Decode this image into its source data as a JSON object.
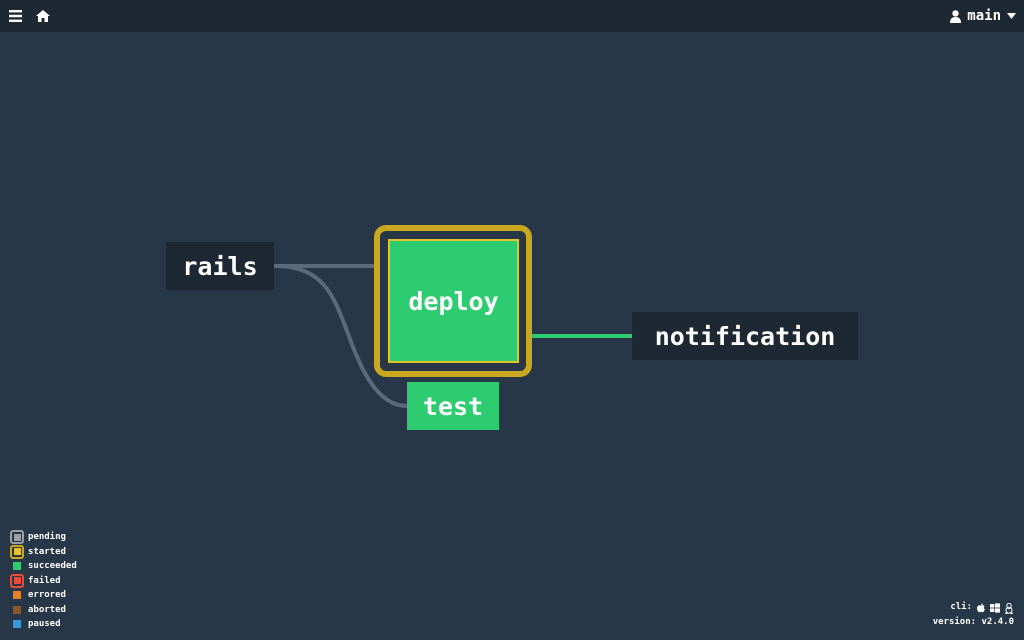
{
  "header": {
    "menu_icon": "hamburger-icon",
    "home_icon": "home-icon",
    "user_icon": "user-icon",
    "user_name": "main",
    "dropdown_icon": "caret-down-icon"
  },
  "pipeline": {
    "jobs": {
      "rails": "rails",
      "deploy": "deploy",
      "test": "test",
      "notification": "notification"
    }
  },
  "legend": {
    "pending": "pending",
    "started": "started",
    "succeeded": "succeeded",
    "failed": "failed",
    "errored": "errored",
    "aborted": "aborted",
    "paused": "paused"
  },
  "footer": {
    "cli_label": "cli:",
    "version_label": "version:",
    "version": "v2.4.0",
    "cli_icons": [
      "apple-icon",
      "windows-icon",
      "linux-icon"
    ]
  },
  "colors": {
    "background": "#273747",
    "topbar": "#1e2833",
    "succeeded": "#2ecc71",
    "started": "#e5c22a",
    "pending": "#9a9fa4",
    "failed": "#e74c3c",
    "errored": "#e67e22",
    "aborted": "#8b572a",
    "paused": "#3498db"
  }
}
